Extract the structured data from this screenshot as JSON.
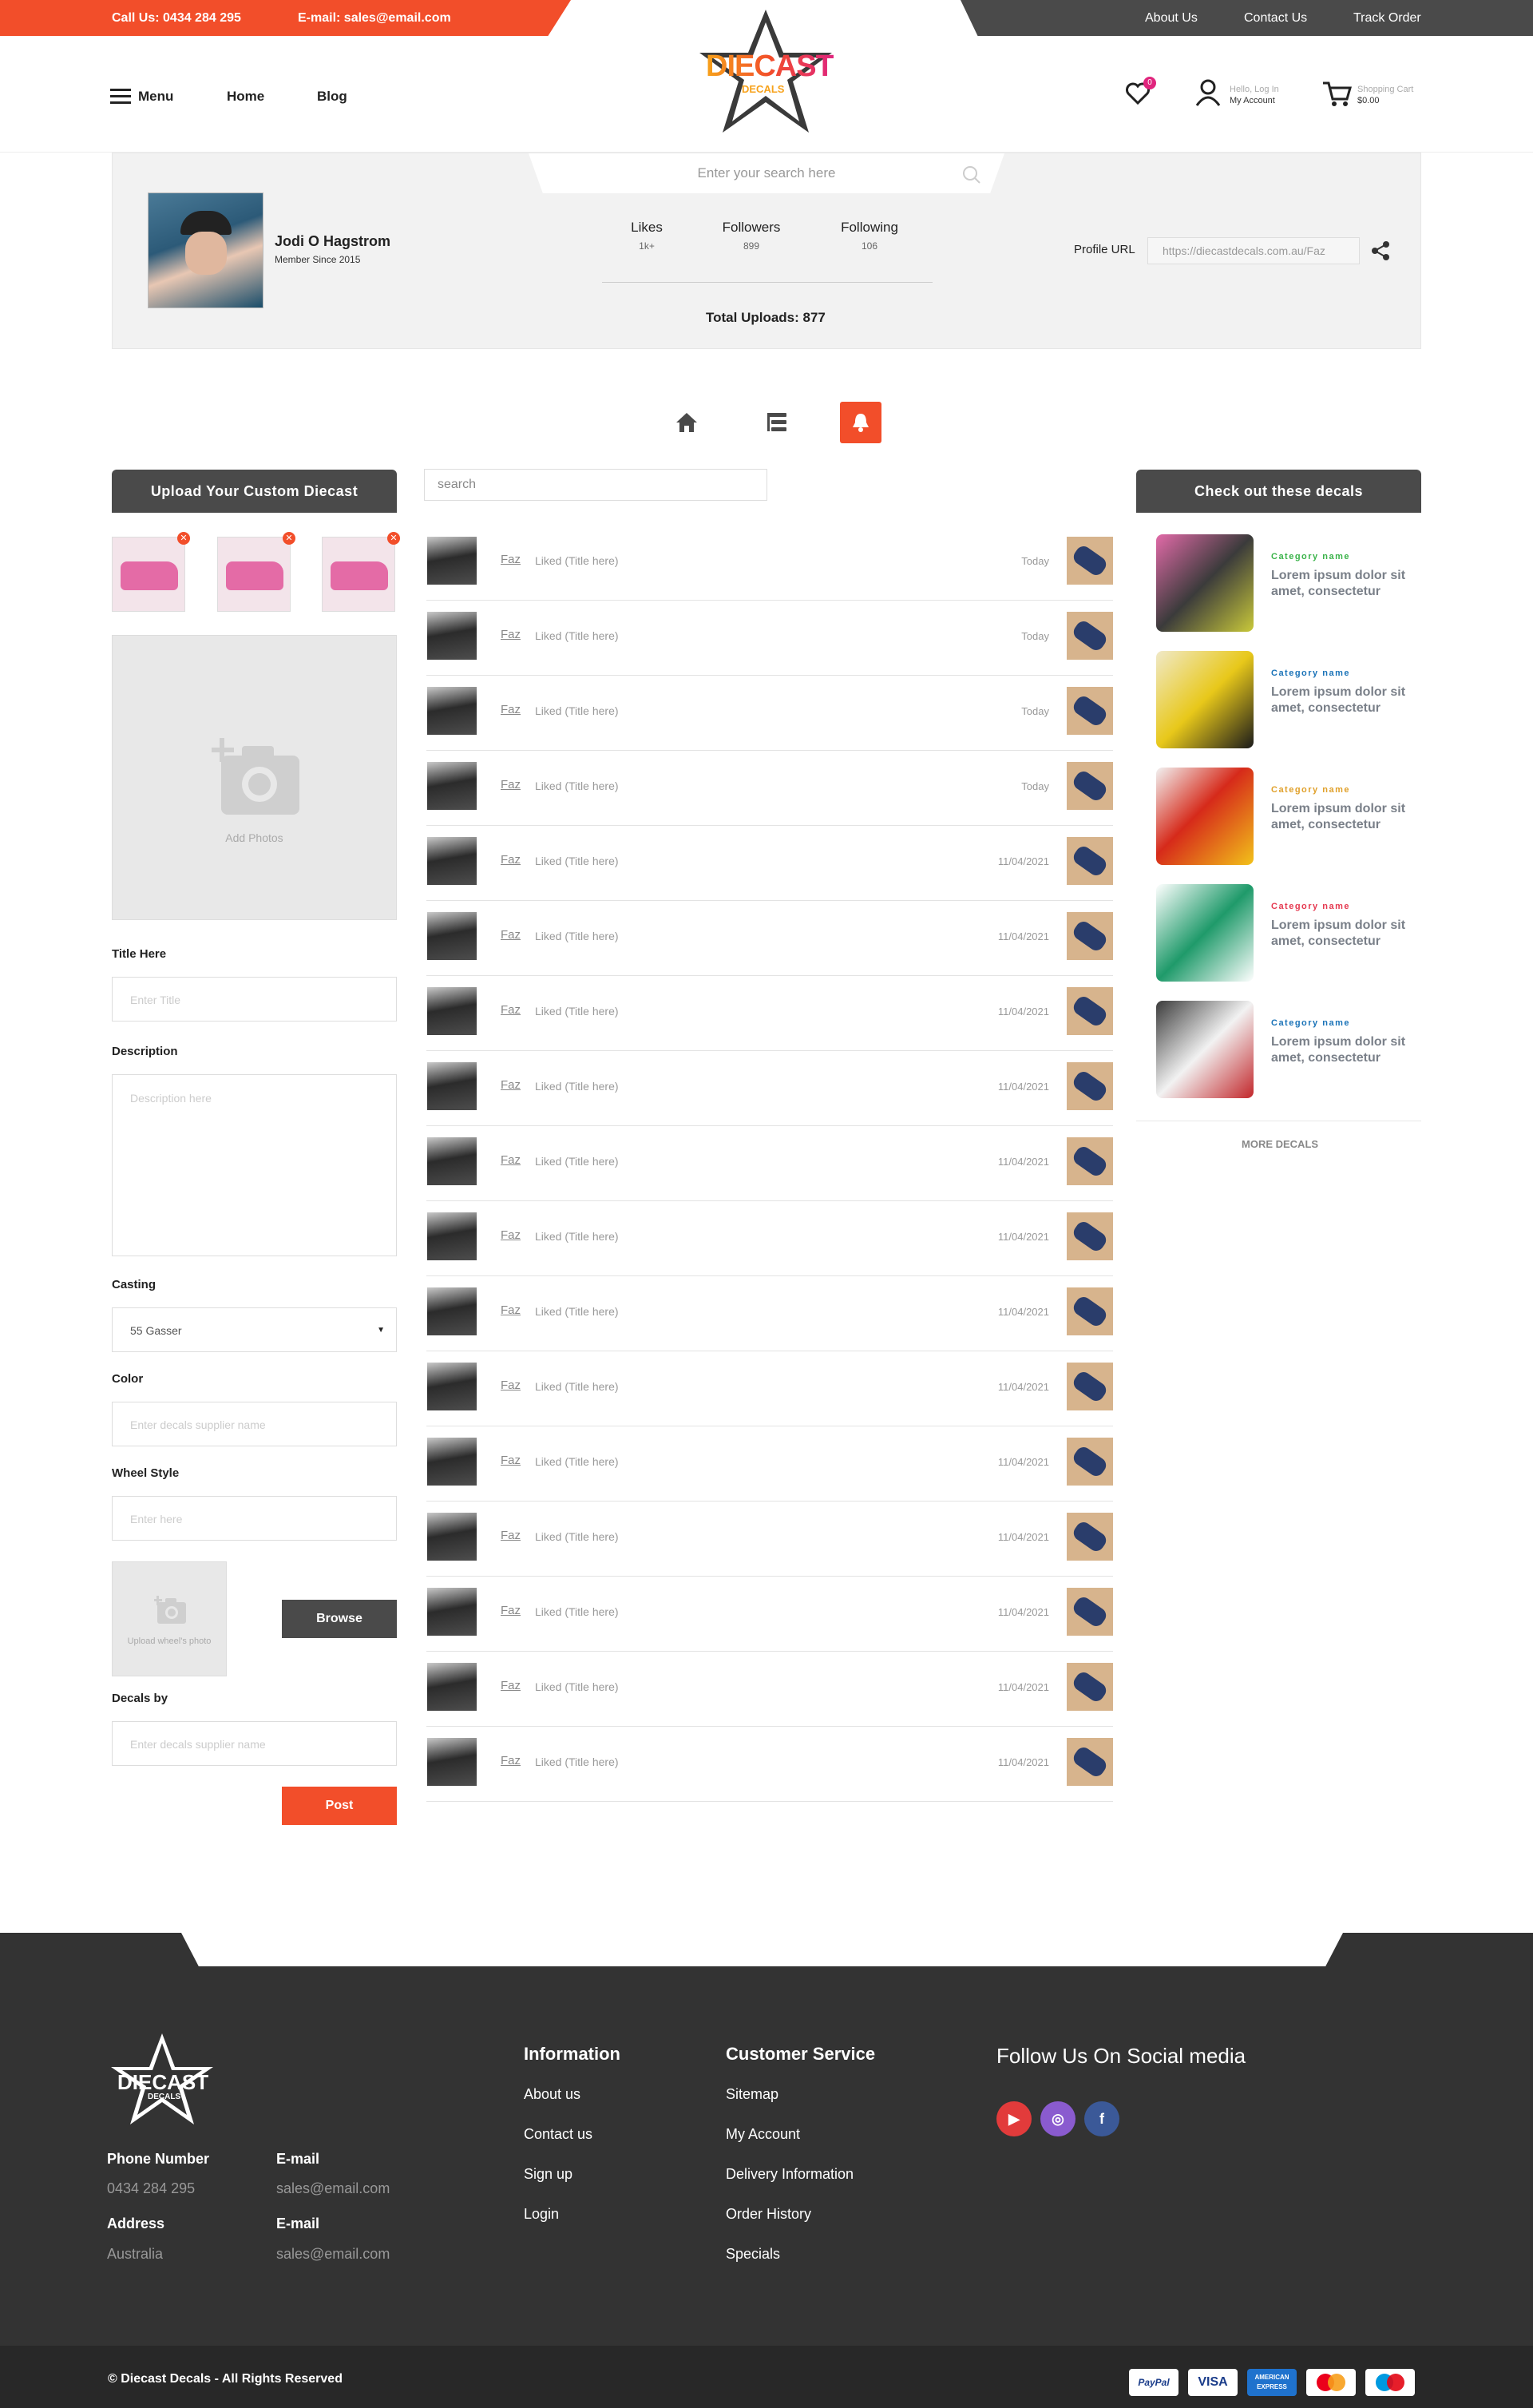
{
  "topbar": {
    "phone": "Call Us: 0434 284 295",
    "email": "E-mail: sales@email.com",
    "links": [
      "About Us",
      "Contact Us",
      "Track Order"
    ]
  },
  "header": {
    "menu": "Menu",
    "home": "Home",
    "blog": "Blog",
    "logo_top": "DIECAST",
    "logo_sub": "DECALS",
    "wishlist_count": "0",
    "account_greeting": "Hello, Log In",
    "account_label": "My Account",
    "cart_label": "Shopping Cart",
    "cart_total": "$0.00"
  },
  "search": {
    "placeholder": "Enter your search here"
  },
  "profile": {
    "name": "Jodi O Hagstrom",
    "member_since": "Member Since 2015",
    "stats": [
      {
        "label": "Likes",
        "value": "1k+"
      },
      {
        "label": "Followers",
        "value": "899"
      },
      {
        "label": "Following",
        "value": "106"
      }
    ],
    "total_uploads": "Total Uploads: 877",
    "url_label": "Profile URL",
    "url_value": "https://diecastdecals.com.au/Faz"
  },
  "upload": {
    "title": "Upload  Your Custom Diecast",
    "add_photos": "Add Photos",
    "title_label": "Title Here",
    "title_placeholder": "Enter Title",
    "description_label": "Description",
    "description_placeholder": "Description here",
    "casting_label": "Casting",
    "casting_value": "55 Gasser",
    "color_label": "Color",
    "color_placeholder": "Enter decals supplier name",
    "wheel_label": "Wheel Style",
    "wheel_placeholder": "Enter here",
    "wheel_photo": "Upload wheel's photo",
    "browse": "Browse",
    "decals_by_label": "Decals by",
    "decals_by_placeholder": "Enter decals supplier name",
    "post": "Post"
  },
  "feed": {
    "search_placeholder": "search",
    "items": [
      {
        "name": "Faz",
        "action": "Liked (Title here)",
        "date": "Today"
      },
      {
        "name": "Faz",
        "action": "Liked (Title here)",
        "date": "Today"
      },
      {
        "name": "Faz",
        "action": "Liked (Title here)",
        "date": "Today"
      },
      {
        "name": "Faz",
        "action": "Liked (Title here)",
        "date": "Today"
      },
      {
        "name": "Faz",
        "action": "Liked (Title here)",
        "date": "11/04/2021"
      },
      {
        "name": "Faz",
        "action": "Liked (Title here)",
        "date": "11/04/2021"
      },
      {
        "name": "Faz",
        "action": "Liked (Title here)",
        "date": "11/04/2021"
      },
      {
        "name": "Faz",
        "action": "Liked (Title here)",
        "date": "11/04/2021"
      },
      {
        "name": "Faz",
        "action": "Liked (Title here)",
        "date": "11/04/2021"
      },
      {
        "name": "Faz",
        "action": "Liked (Title here)",
        "date": "11/04/2021"
      },
      {
        "name": "Faz",
        "action": "Liked (Title here)",
        "date": "11/04/2021"
      },
      {
        "name": "Faz",
        "action": "Liked (Title here)",
        "date": "11/04/2021"
      },
      {
        "name": "Faz",
        "action": "Liked (Title here)",
        "date": "11/04/2021"
      },
      {
        "name": "Faz",
        "action": "Liked (Title here)",
        "date": "11/04/2021"
      },
      {
        "name": "Faz",
        "action": "Liked (Title here)",
        "date": "11/04/2021"
      },
      {
        "name": "Faz",
        "action": "Liked (Title here)",
        "date": "11/04/2021"
      },
      {
        "name": "Faz",
        "action": "Liked (Title here)",
        "date": "11/04/2021"
      }
    ]
  },
  "decals": {
    "title": "Check out these decals",
    "items": [
      {
        "category": "Category name",
        "color": "#3bb34a",
        "text": "Lorem ipsum dolor sit amet, consectetur"
      },
      {
        "category": "Category name",
        "color": "#1a73b8",
        "text": "Lorem ipsum dolor sit amet, consectetur"
      },
      {
        "category": "Category name",
        "color": "#e0a02a",
        "text": "Lorem ipsum dolor sit amet, consectetur"
      },
      {
        "category": "Category name",
        "color": "#e53950",
        "text": "Lorem ipsum dolor sit amet, consectetur"
      },
      {
        "category": "Category name",
        "color": "#1a73b8",
        "text": "Lorem ipsum dolor sit amet, consectetur"
      }
    ],
    "more": "MORE DECALS"
  },
  "footer": {
    "logo_top": "DIECAST",
    "logo_sub": "DECALS",
    "phone_label": "Phone Number",
    "phone": "0434 284 295",
    "email_label": "E-mail",
    "email": "sales@email.com",
    "address_label": "Address",
    "address": "Australia",
    "email2_label": "E-mail",
    "email2": "sales@email.com",
    "information_title": "Information",
    "information": [
      "About us",
      "Contact us",
      "Sign up",
      "Login"
    ],
    "service_title": "Customer Service",
    "service": [
      "Sitemap",
      "My Account",
      "Delivery Information",
      "Order History",
      "Specials"
    ],
    "social_title": "Follow Us On Social media",
    "copyright": "© Diecast Decals - All Rights Reserved",
    "payments": [
      "PayPal",
      "VISA",
      "AMERICAN EXPRESS",
      "mastercard",
      "maestro"
    ]
  },
  "colors": {
    "accent": "#f24e2a",
    "dark": "#4a4a4a",
    "footer": "#333333"
  }
}
